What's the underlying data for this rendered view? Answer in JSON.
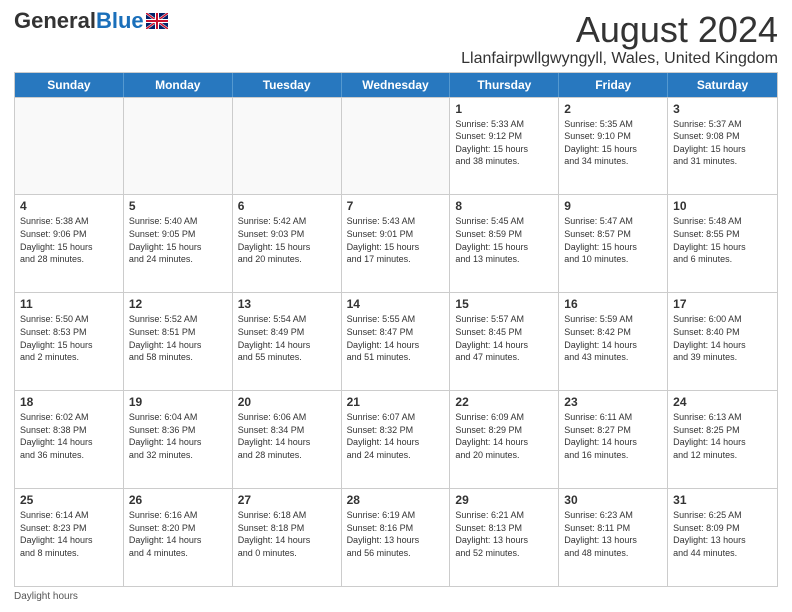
{
  "header": {
    "logo": {
      "general": "General",
      "blue": "Blue"
    },
    "title": "August 2024",
    "subtitle": "Llanfairpwllgwyngyll, Wales, United Kingdom"
  },
  "calendar": {
    "headers": [
      "Sunday",
      "Monday",
      "Tuesday",
      "Wednesday",
      "Thursday",
      "Friday",
      "Saturday"
    ],
    "rows": [
      [
        {
          "day": "",
          "info": ""
        },
        {
          "day": "",
          "info": ""
        },
        {
          "day": "",
          "info": ""
        },
        {
          "day": "",
          "info": ""
        },
        {
          "day": "1",
          "info": "Sunrise: 5:33 AM\nSunset: 9:12 PM\nDaylight: 15 hours\nand 38 minutes."
        },
        {
          "day": "2",
          "info": "Sunrise: 5:35 AM\nSunset: 9:10 PM\nDaylight: 15 hours\nand 34 minutes."
        },
        {
          "day": "3",
          "info": "Sunrise: 5:37 AM\nSunset: 9:08 PM\nDaylight: 15 hours\nand 31 minutes."
        }
      ],
      [
        {
          "day": "4",
          "info": "Sunrise: 5:38 AM\nSunset: 9:06 PM\nDaylight: 15 hours\nand 28 minutes."
        },
        {
          "day": "5",
          "info": "Sunrise: 5:40 AM\nSunset: 9:05 PM\nDaylight: 15 hours\nand 24 minutes."
        },
        {
          "day": "6",
          "info": "Sunrise: 5:42 AM\nSunset: 9:03 PM\nDaylight: 15 hours\nand 20 minutes."
        },
        {
          "day": "7",
          "info": "Sunrise: 5:43 AM\nSunset: 9:01 PM\nDaylight: 15 hours\nand 17 minutes."
        },
        {
          "day": "8",
          "info": "Sunrise: 5:45 AM\nSunset: 8:59 PM\nDaylight: 15 hours\nand 13 minutes."
        },
        {
          "day": "9",
          "info": "Sunrise: 5:47 AM\nSunset: 8:57 PM\nDaylight: 15 hours\nand 10 minutes."
        },
        {
          "day": "10",
          "info": "Sunrise: 5:48 AM\nSunset: 8:55 PM\nDaylight: 15 hours\nand 6 minutes."
        }
      ],
      [
        {
          "day": "11",
          "info": "Sunrise: 5:50 AM\nSunset: 8:53 PM\nDaylight: 15 hours\nand 2 minutes."
        },
        {
          "day": "12",
          "info": "Sunrise: 5:52 AM\nSunset: 8:51 PM\nDaylight: 14 hours\nand 58 minutes."
        },
        {
          "day": "13",
          "info": "Sunrise: 5:54 AM\nSunset: 8:49 PM\nDaylight: 14 hours\nand 55 minutes."
        },
        {
          "day": "14",
          "info": "Sunrise: 5:55 AM\nSunset: 8:47 PM\nDaylight: 14 hours\nand 51 minutes."
        },
        {
          "day": "15",
          "info": "Sunrise: 5:57 AM\nSunset: 8:45 PM\nDaylight: 14 hours\nand 47 minutes."
        },
        {
          "day": "16",
          "info": "Sunrise: 5:59 AM\nSunset: 8:42 PM\nDaylight: 14 hours\nand 43 minutes."
        },
        {
          "day": "17",
          "info": "Sunrise: 6:00 AM\nSunset: 8:40 PM\nDaylight: 14 hours\nand 39 minutes."
        }
      ],
      [
        {
          "day": "18",
          "info": "Sunrise: 6:02 AM\nSunset: 8:38 PM\nDaylight: 14 hours\nand 36 minutes."
        },
        {
          "day": "19",
          "info": "Sunrise: 6:04 AM\nSunset: 8:36 PM\nDaylight: 14 hours\nand 32 minutes."
        },
        {
          "day": "20",
          "info": "Sunrise: 6:06 AM\nSunset: 8:34 PM\nDaylight: 14 hours\nand 28 minutes."
        },
        {
          "day": "21",
          "info": "Sunrise: 6:07 AM\nSunset: 8:32 PM\nDaylight: 14 hours\nand 24 minutes."
        },
        {
          "day": "22",
          "info": "Sunrise: 6:09 AM\nSunset: 8:29 PM\nDaylight: 14 hours\nand 20 minutes."
        },
        {
          "day": "23",
          "info": "Sunrise: 6:11 AM\nSunset: 8:27 PM\nDaylight: 14 hours\nand 16 minutes."
        },
        {
          "day": "24",
          "info": "Sunrise: 6:13 AM\nSunset: 8:25 PM\nDaylight: 14 hours\nand 12 minutes."
        }
      ],
      [
        {
          "day": "25",
          "info": "Sunrise: 6:14 AM\nSunset: 8:23 PM\nDaylight: 14 hours\nand 8 minutes."
        },
        {
          "day": "26",
          "info": "Sunrise: 6:16 AM\nSunset: 8:20 PM\nDaylight: 14 hours\nand 4 minutes."
        },
        {
          "day": "27",
          "info": "Sunrise: 6:18 AM\nSunset: 8:18 PM\nDaylight: 14 hours\nand 0 minutes."
        },
        {
          "day": "28",
          "info": "Sunrise: 6:19 AM\nSunset: 8:16 PM\nDaylight: 13 hours\nand 56 minutes."
        },
        {
          "day": "29",
          "info": "Sunrise: 6:21 AM\nSunset: 8:13 PM\nDaylight: 13 hours\nand 52 minutes."
        },
        {
          "day": "30",
          "info": "Sunrise: 6:23 AM\nSunset: 8:11 PM\nDaylight: 13 hours\nand 48 minutes."
        },
        {
          "day": "31",
          "info": "Sunrise: 6:25 AM\nSunset: 8:09 PM\nDaylight: 13 hours\nand 44 minutes."
        }
      ]
    ]
  },
  "footer": {
    "daylight_label": "Daylight hours"
  },
  "colors": {
    "header_bg": "#2878bf",
    "header_text": "#ffffff",
    "border": "#cccccc",
    "text": "#333333"
  }
}
